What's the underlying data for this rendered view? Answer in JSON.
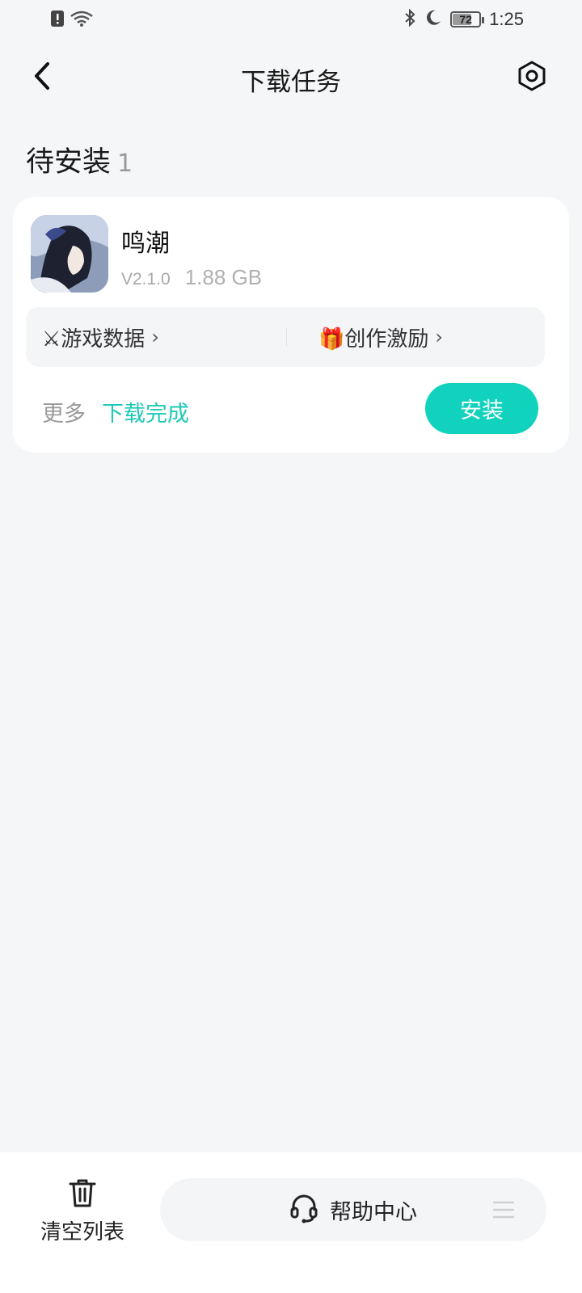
{
  "status_bar": {
    "time": "1:25",
    "battery_percent": "72",
    "battery_level": 0.72,
    "icons": [
      "sim-alert-icon",
      "wifi-icon",
      "bluetooth-icon",
      "moon-icon",
      "battery-icon"
    ]
  },
  "header": {
    "title": "下载任务",
    "back_icon": "back-arrow-icon",
    "settings_icon": "settings-icon"
  },
  "section": {
    "title": "待安装",
    "count": "1"
  },
  "task": {
    "app_name": "鸣潮",
    "version": "V2.1.0",
    "size": "1.88 GB",
    "link_game_data": "⚔游戏数据",
    "link_creator_reward": "🎁创作激励",
    "more_label": "更多",
    "status": "下载完成",
    "install_label": "安装"
  },
  "bottom": {
    "clear_label": "清空列表",
    "help_label": "帮助中心"
  },
  "colors": {
    "accent": "#10d2bd",
    "status_text": "#1fc8b7",
    "background": "#f5f6f8"
  }
}
